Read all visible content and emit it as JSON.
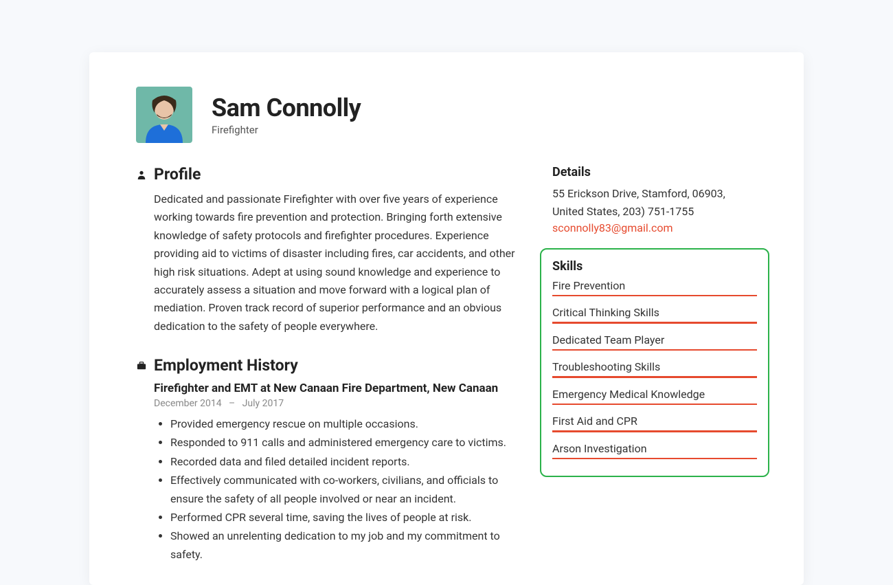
{
  "header": {
    "name": "Sam Connolly",
    "title": "Firefighter"
  },
  "profile": {
    "section_title": "Profile",
    "text": "Dedicated and passionate Firefighter with over five years of experience working towards fire prevention and protection. Bringing forth extensive knowledge of safety protocols and firefighter procedures. Experience providing aid to victims of disaster including fires, car accidents, and other high risk situations. Adept at using sound knowledge and experience to accurately assess a situation and move forward with a logical plan of mediation. Proven track record of superior performance and an obvious dedication to the safety of people everywhere."
  },
  "employment": {
    "section_title": "Employment History",
    "jobs": [
      {
        "title": "Firefighter and EMT at New Canaan Fire Department, New Canaan",
        "start": "December 2014",
        "sep": "–",
        "end": "July 2017",
        "bullets": [
          "Provided emergency rescue on multiple occasions.",
          "Responded to 911 calls and administered emergency care to victims.",
          "Recorded data and filed detailed incident reports.",
          "Effectively communicated with co-workers, civilians, and officials to ensure the safety of all people involved or near an incident.",
          "Performed CPR several time, saving the lives of people at risk.",
          "Showed an unrelenting dedication to my job and my commitment to safety."
        ]
      }
    ]
  },
  "details": {
    "section_title": "Details",
    "address": "55 Erickson Drive, Stamford, 06903, United States, 203) 751-1755",
    "email": "sconnolly83@gmail.com"
  },
  "skills": {
    "section_title": "Skills",
    "items": [
      "Fire Prevention",
      "Critical Thinking Skills",
      "Dedicated Team Player",
      "Troubleshooting Skills",
      "Emergency Medical Knowledge",
      "First Aid and CPR",
      "Arson Investigation"
    ]
  }
}
